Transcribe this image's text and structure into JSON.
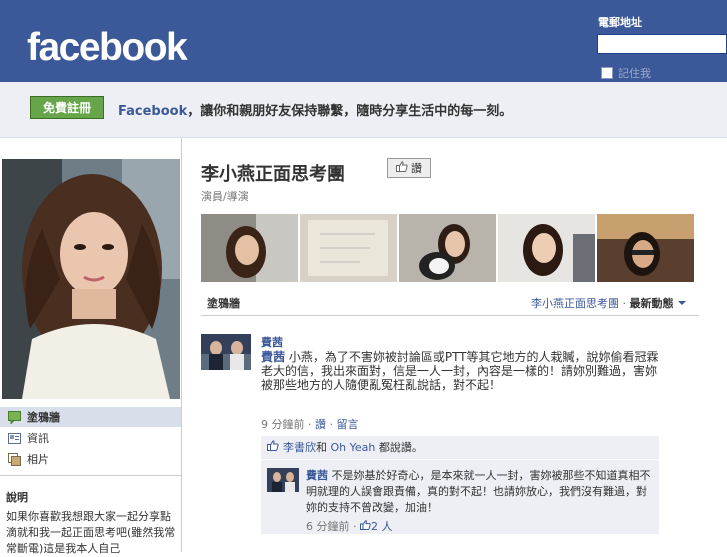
{
  "header": {
    "logo": "facebook",
    "email_label": "電郵地址",
    "remember_label": "記住我"
  },
  "signup": {
    "button_label": "免費註冊",
    "tagline_brand": "Facebook",
    "tagline_rest": "，讓你和親朋好友保持聯繫，隨時分享生活中的每一刻。"
  },
  "sidebar": {
    "items": [
      {
        "label": "塗鴉牆",
        "icon": "wall-icon"
      },
      {
        "label": "資訊",
        "icon": "info-icon"
      },
      {
        "label": "相片",
        "icon": "photos-icon"
      }
    ],
    "description_title": "說明",
    "description_text": "如果你喜歡我想跟大家一起分享點滴就和我一起正面思考吧(雖然我常常斷電)這是我本人自己"
  },
  "page": {
    "title": "李小燕正面思考團",
    "like_label": "讚",
    "subtitle": "演員/導演"
  },
  "wall": {
    "label": "塗鴉牆",
    "filter_page": "李小燕正面思考團",
    "filter_sep": " · ",
    "filter_mode": "最新動態"
  },
  "post": {
    "author": "費茜",
    "text_author": "費茜",
    "text": " 小燕，為了不害妳被討論區或PTT等其它地方的人栽贓，說妳偷看冠霖老大的信，我出來面對，信是一人一封，內容是一樣的！請妳別難過，害妳被那些地方的人隨便亂冤枉亂說話，對不起！",
    "time": "9 分鐘前",
    "sep": " · ",
    "like_link": "讚",
    "comment_link": "留言",
    "likes_names_1": "李書欣",
    "likes_and": "和",
    "likes_names_2": "Oh Yeah",
    "likes_suffix": "都說讚。"
  },
  "comment": {
    "author": "費茜",
    "text": " 不是妳基於好奇心，是本來就一人一封，害妳被那些不知道真相不明就理的人誤會跟責備，真的對不起！也請妳放心，我們沒有難過，對妳的支持不曾改變，加油！",
    "time": "6 分鐘前",
    "sep": " · ",
    "likes_count": "2 人"
  },
  "colors": {
    "brand": "#3b5998",
    "signup_green": "#67a54b",
    "panel": "#edeff4"
  }
}
